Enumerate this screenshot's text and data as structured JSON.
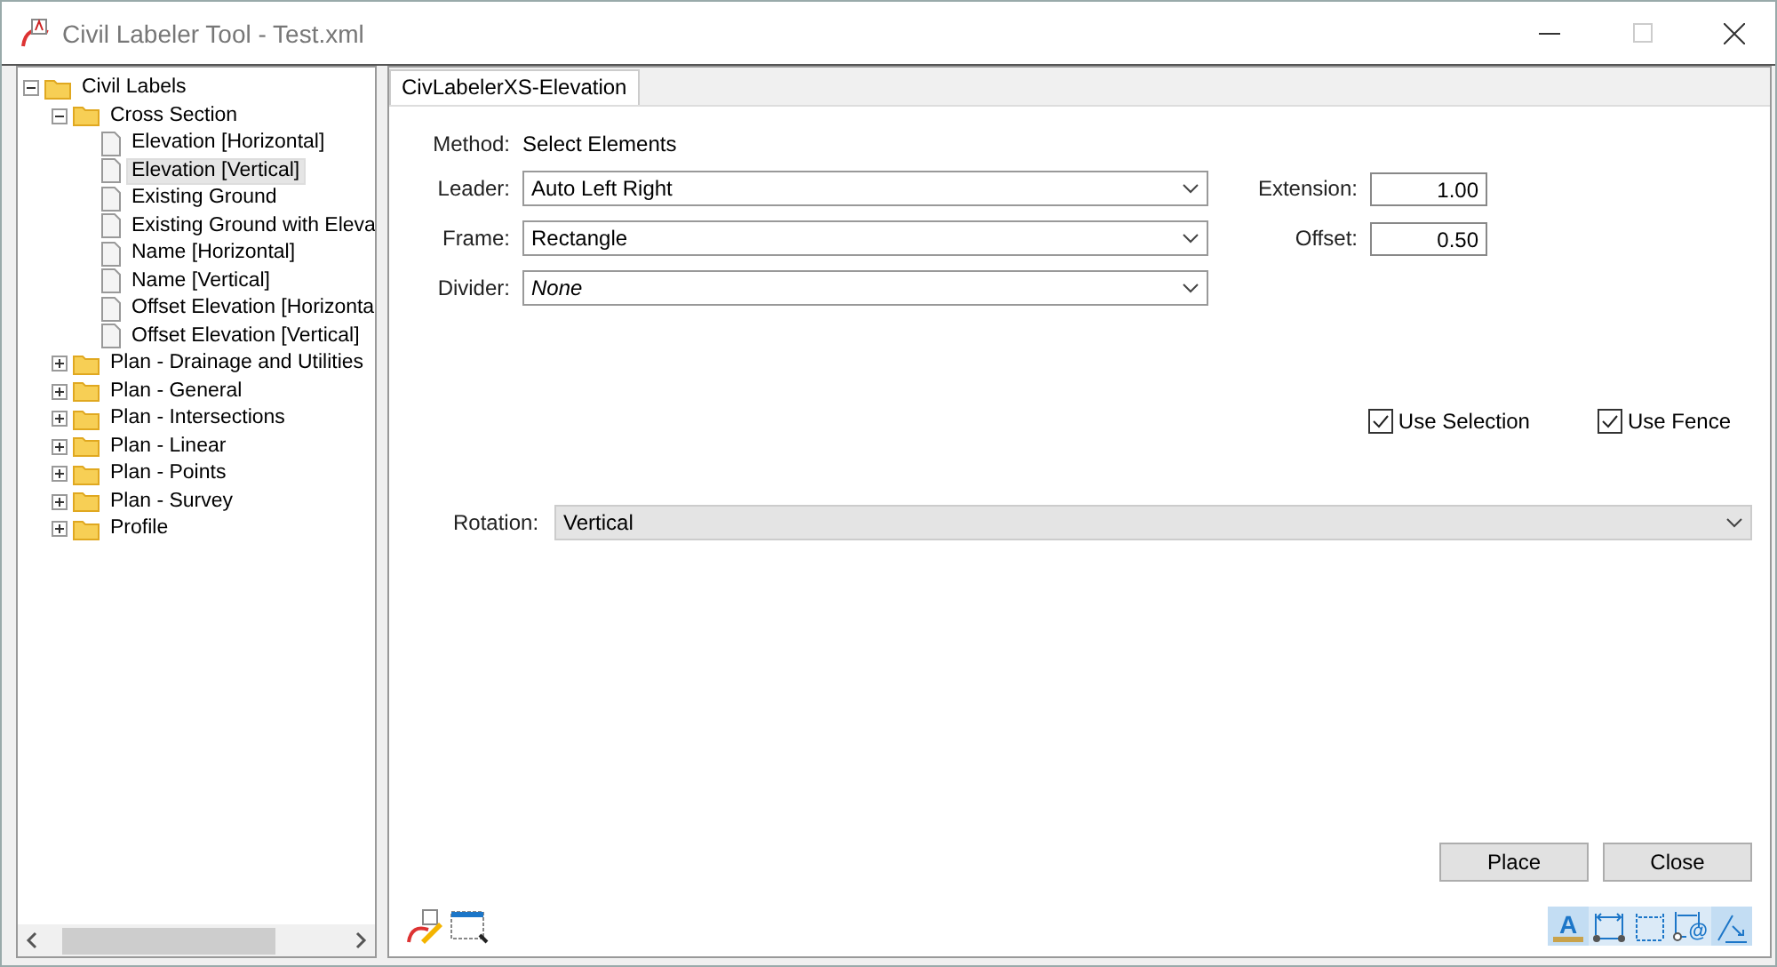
{
  "window": {
    "title": "Civil Labeler Tool - Test.xml"
  },
  "tree": [
    {
      "label": "Civil Labels",
      "kind": "folder",
      "expanded": true,
      "selected": false,
      "children": [
        {
          "label": "Cross Section",
          "kind": "folder",
          "expanded": true,
          "selected": false,
          "children": [
            {
              "label": "Elevation [Horizontal]",
              "kind": "leaf",
              "selected": false
            },
            {
              "label": "Elevation [Vertical]",
              "kind": "leaf",
              "selected": true
            },
            {
              "label": "Existing Ground",
              "kind": "leaf",
              "selected": false
            },
            {
              "label": "Existing Ground with Eleva",
              "kind": "leaf",
              "selected": false
            },
            {
              "label": "Name [Horizontal]",
              "kind": "leaf",
              "selected": false
            },
            {
              "label": "Name [Vertical]",
              "kind": "leaf",
              "selected": false
            },
            {
              "label": "Offset Elevation [Horizonta",
              "kind": "leaf",
              "selected": false
            },
            {
              "label": "Offset Elevation [Vertical]",
              "kind": "leaf",
              "selected": false
            }
          ]
        },
        {
          "label": "Plan - Drainage and Utilities",
          "kind": "folder",
          "expanded": false,
          "selected": false
        },
        {
          "label": "Plan - General",
          "kind": "folder",
          "expanded": false,
          "selected": false
        },
        {
          "label": "Plan - Intersections",
          "kind": "folder",
          "expanded": false,
          "selected": false
        },
        {
          "label": "Plan - Linear",
          "kind": "folder",
          "expanded": false,
          "selected": false
        },
        {
          "label": "Plan - Points",
          "kind": "folder",
          "expanded": false,
          "selected": false
        },
        {
          "label": "Plan - Survey",
          "kind": "folder",
          "expanded": false,
          "selected": false
        },
        {
          "label": "Profile",
          "kind": "folder",
          "expanded": false,
          "selected": false
        }
      ]
    }
  ],
  "tabs": [
    {
      "label": "CivLabelerXS-Elevation",
      "selected": true
    }
  ],
  "method": {
    "label": "Method:",
    "value": "Select Elements"
  },
  "dropdowns": [
    {
      "label": "Leader:",
      "value": "Auto Left Right",
      "italic": false
    },
    {
      "label": "Frame:",
      "value": "Rectangle",
      "italic": false
    },
    {
      "label": "Divider:",
      "value": "None",
      "italic": true
    }
  ],
  "fields": [
    {
      "label": "Extension:",
      "value": "1.00"
    },
    {
      "label": "Offset:",
      "value": "0.50"
    }
  ],
  "checkboxes": [
    {
      "label": "Use Selection",
      "checked": true
    },
    {
      "label": "Use Fence",
      "checked": true
    }
  ],
  "rotation": {
    "label": "Rotation:",
    "value": "Vertical"
  },
  "buttons": [
    "Place",
    "Close"
  ],
  "tools": [
    {
      "kind": "text-style",
      "label": "A",
      "selected": true
    },
    {
      "kind": "dimension-points",
      "selected": false
    },
    {
      "kind": "dimension-box",
      "selected": false
    },
    {
      "kind": "dimension-at",
      "label": "@",
      "selected": false
    },
    {
      "kind": "leader-angle",
      "selected": true
    }
  ]
}
